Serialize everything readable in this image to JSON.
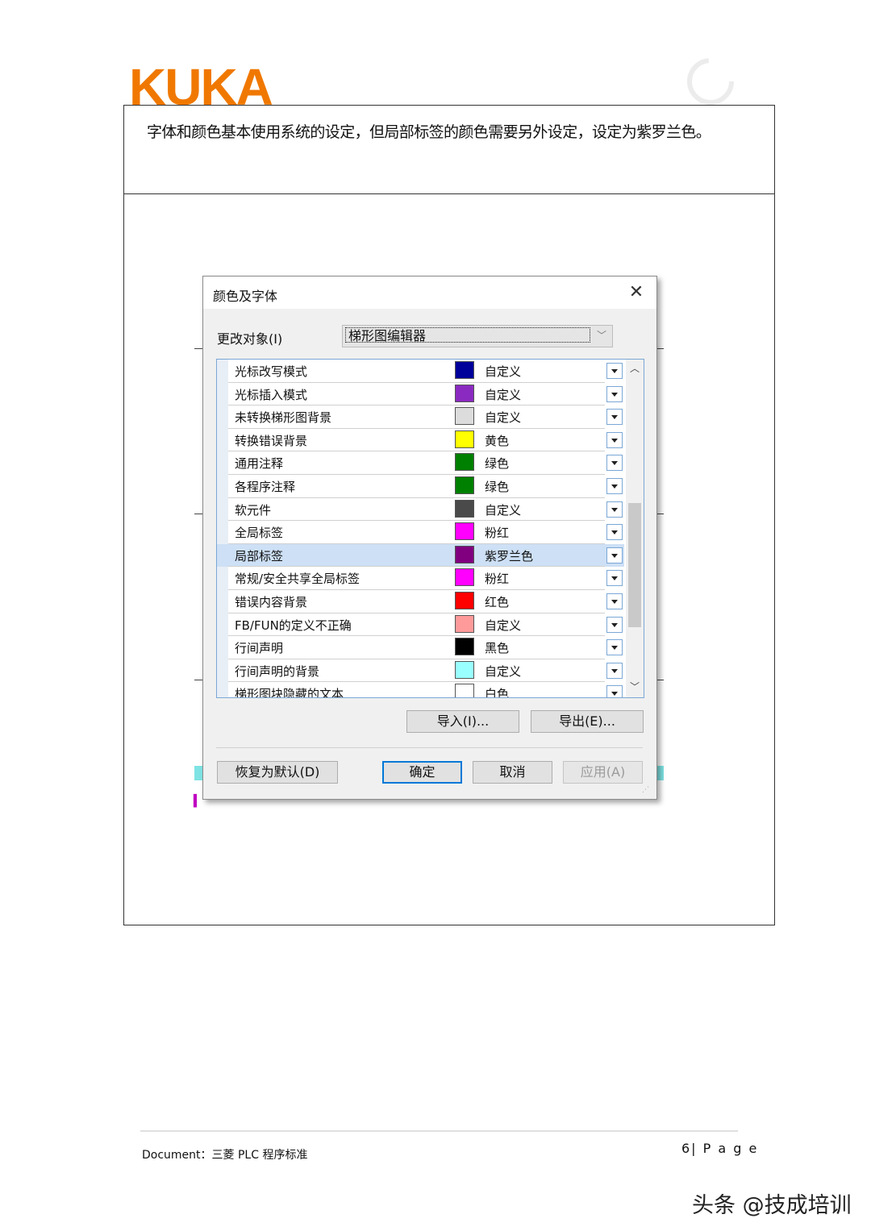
{
  "brand": {
    "logo_text": "KUKA",
    "logo_color": "#f07800"
  },
  "description": "字体和颜色基本使用系统的设定，但局部标签的颜色需要另外设定，设定为紫罗兰色。",
  "dialog": {
    "title": "颜色及字体",
    "close_glyph": "✕",
    "target_label": "更改对象(I)",
    "target_value": "梯形图编辑器",
    "items": [
      {
        "name": "光标改写模式",
        "color": "#00009a",
        "color_name": "自定义"
      },
      {
        "name": "光标插入模式",
        "color": "#8a2ac0",
        "color_name": "自定义"
      },
      {
        "name": "未转换梯形图背景",
        "color": "#dcdcdc",
        "color_name": "自定义"
      },
      {
        "name": "转换错误背景",
        "color": "#ffff00",
        "color_name": "黄色"
      },
      {
        "name": "通用注释",
        "color": "#008000",
        "color_name": "绿色"
      },
      {
        "name": "各程序注释",
        "color": "#008000",
        "color_name": "绿色"
      },
      {
        "name": "软元件",
        "color": "#4a4a4a",
        "color_name": "自定义"
      },
      {
        "name": "全局标签",
        "color": "#ff00ff",
        "color_name": "粉红"
      },
      {
        "name": "局部标签",
        "color": "#800080",
        "color_name": "紫罗兰色",
        "selected": true
      },
      {
        "name": "常规/安全共享全局标签",
        "color": "#ff00ff",
        "color_name": "粉红"
      },
      {
        "name": "错误内容背景",
        "color": "#ff0000",
        "color_name": "红色"
      },
      {
        "name": "FB/FUN的定义不正确",
        "color": "#ff9a9a",
        "color_name": "自定义"
      },
      {
        "name": "行间声明",
        "color": "#000000",
        "color_name": "黑色"
      },
      {
        "name": "行间声明的背景",
        "color": "#9affff",
        "color_name": "自定义"
      },
      {
        "name": "梯形图块隐藏的文本",
        "color": "#ffffff",
        "color_name": "白色"
      }
    ],
    "import_label": "导入(I)...",
    "export_label": "导出(E)...",
    "reset_label": "恢复为默认(D)",
    "ok_label": "确定",
    "cancel_label": "取消",
    "apply_label": "应用(A)"
  },
  "footer": {
    "document": "Document：三菱 PLC 程序标准",
    "page": "6| P a g e"
  },
  "watermark": "头条 @技成培训"
}
